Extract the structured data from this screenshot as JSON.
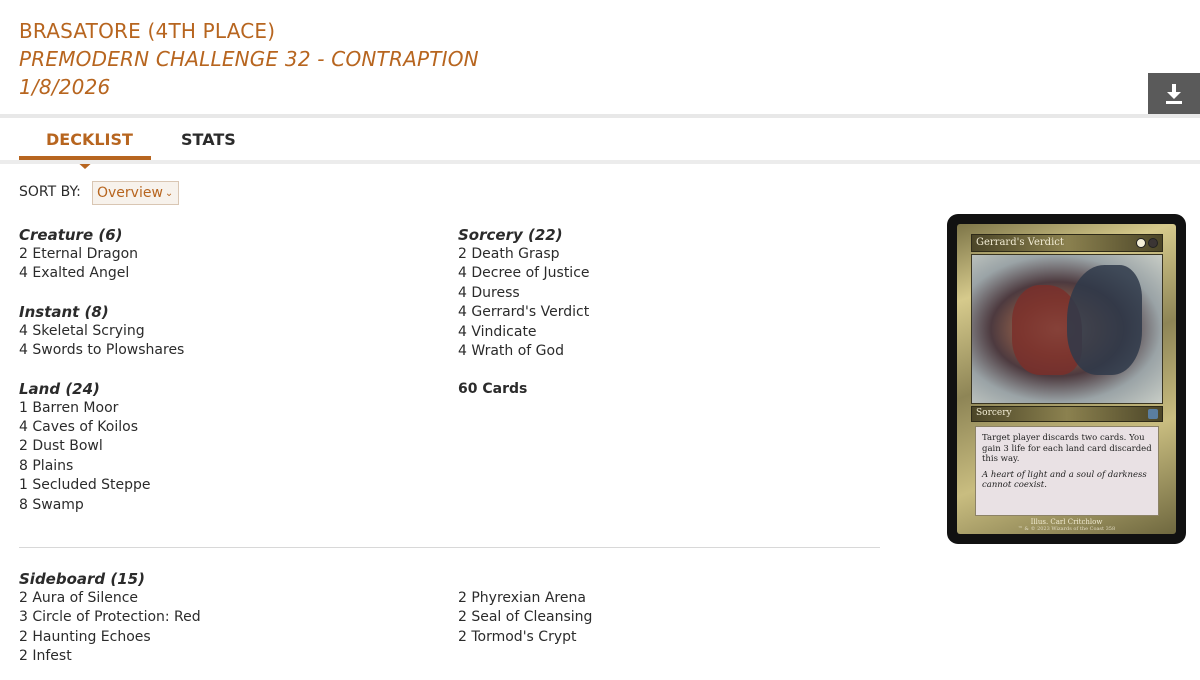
{
  "header": {
    "player": "BRASATORE (4TH PLACE)",
    "event": "PREMODERN CHALLENGE 32 - CONTRAPTION",
    "date": "1/8/2026",
    "download_icon": "download-icon"
  },
  "tabs": [
    {
      "label": "DECKLIST",
      "active": true
    },
    {
      "label": "STATS",
      "active": false
    }
  ],
  "sort": {
    "label": "SORT BY:",
    "selected": "Overview"
  },
  "colors": {
    "accent": "#b7651f",
    "text": "#2b2b2b",
    "download_bg": "#5a5a5a"
  },
  "main_left": [
    {
      "heading": "Creature (6)",
      "cards": [
        "2 Eternal Dragon",
        "4 Exalted Angel"
      ]
    },
    {
      "heading": "Instant (8)",
      "cards": [
        "4 Skeletal Scrying",
        "4 Swords to Plowshares"
      ]
    },
    {
      "heading": "Land (24)",
      "cards": [
        "1 Barren Moor",
        "4 Caves of Koilos",
        "2 Dust Bowl",
        "8 Plains",
        "1 Secluded Steppe",
        "8 Swamp"
      ]
    }
  ],
  "main_right": [
    {
      "heading": "Sorcery (22)",
      "cards": [
        "2 Death Grasp",
        "4 Decree of Justice",
        "4 Duress",
        "4 Gerrard's Verdict",
        "4 Vindicate",
        "4 Wrath of God"
      ]
    }
  ],
  "total": "60 Cards",
  "sideboard": {
    "heading": "Sideboard (15)",
    "left": [
      "2 Aura of Silence",
      "3 Circle of Protection: Red",
      "2 Haunting Echoes",
      "2 Infest"
    ],
    "right": [
      "2 Phyrexian Arena",
      "2 Seal of Cleansing",
      "2 Tormod's Crypt"
    ]
  },
  "card_preview": {
    "name": "Gerrard's Verdict",
    "type": "Sorcery",
    "rules": "Target player discards two cards. You gain 3 life for each land card discarded this way.",
    "flavor": "A heart of light and a soul of darkness cannot coexist.",
    "illustrator": "Illus. Carl Critchlow",
    "copyright": "™ & © 2023 Wizards of the Coast 358"
  }
}
